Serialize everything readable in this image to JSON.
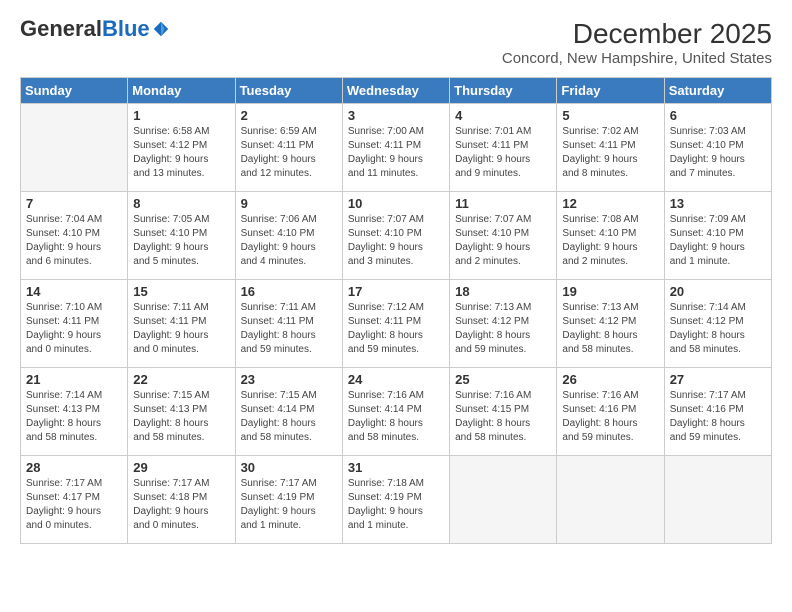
{
  "header": {
    "logo_general": "General",
    "logo_blue": "Blue",
    "title": "December 2025",
    "subtitle": "Concord, New Hampshire, United States"
  },
  "calendar": {
    "days_of_week": [
      "Sunday",
      "Monday",
      "Tuesday",
      "Wednesday",
      "Thursday",
      "Friday",
      "Saturday"
    ],
    "weeks": [
      [
        {
          "day": "",
          "info": ""
        },
        {
          "day": "1",
          "info": "Sunrise: 6:58 AM\nSunset: 4:12 PM\nDaylight: 9 hours\nand 13 minutes."
        },
        {
          "day": "2",
          "info": "Sunrise: 6:59 AM\nSunset: 4:11 PM\nDaylight: 9 hours\nand 12 minutes."
        },
        {
          "day": "3",
          "info": "Sunrise: 7:00 AM\nSunset: 4:11 PM\nDaylight: 9 hours\nand 11 minutes."
        },
        {
          "day": "4",
          "info": "Sunrise: 7:01 AM\nSunset: 4:11 PM\nDaylight: 9 hours\nand 9 minutes."
        },
        {
          "day": "5",
          "info": "Sunrise: 7:02 AM\nSunset: 4:11 PM\nDaylight: 9 hours\nand 8 minutes."
        },
        {
          "day": "6",
          "info": "Sunrise: 7:03 AM\nSunset: 4:10 PM\nDaylight: 9 hours\nand 7 minutes."
        }
      ],
      [
        {
          "day": "7",
          "info": "Sunrise: 7:04 AM\nSunset: 4:10 PM\nDaylight: 9 hours\nand 6 minutes."
        },
        {
          "day": "8",
          "info": "Sunrise: 7:05 AM\nSunset: 4:10 PM\nDaylight: 9 hours\nand 5 minutes."
        },
        {
          "day": "9",
          "info": "Sunrise: 7:06 AM\nSunset: 4:10 PM\nDaylight: 9 hours\nand 4 minutes."
        },
        {
          "day": "10",
          "info": "Sunrise: 7:07 AM\nSunset: 4:10 PM\nDaylight: 9 hours\nand 3 minutes."
        },
        {
          "day": "11",
          "info": "Sunrise: 7:07 AM\nSunset: 4:10 PM\nDaylight: 9 hours\nand 2 minutes."
        },
        {
          "day": "12",
          "info": "Sunrise: 7:08 AM\nSunset: 4:10 PM\nDaylight: 9 hours\nand 2 minutes."
        },
        {
          "day": "13",
          "info": "Sunrise: 7:09 AM\nSunset: 4:10 PM\nDaylight: 9 hours\nand 1 minute."
        }
      ],
      [
        {
          "day": "14",
          "info": "Sunrise: 7:10 AM\nSunset: 4:11 PM\nDaylight: 9 hours\nand 0 minutes."
        },
        {
          "day": "15",
          "info": "Sunrise: 7:11 AM\nSunset: 4:11 PM\nDaylight: 9 hours\nand 0 minutes."
        },
        {
          "day": "16",
          "info": "Sunrise: 7:11 AM\nSunset: 4:11 PM\nDaylight: 8 hours\nand 59 minutes."
        },
        {
          "day": "17",
          "info": "Sunrise: 7:12 AM\nSunset: 4:11 PM\nDaylight: 8 hours\nand 59 minutes."
        },
        {
          "day": "18",
          "info": "Sunrise: 7:13 AM\nSunset: 4:12 PM\nDaylight: 8 hours\nand 59 minutes."
        },
        {
          "day": "19",
          "info": "Sunrise: 7:13 AM\nSunset: 4:12 PM\nDaylight: 8 hours\nand 58 minutes."
        },
        {
          "day": "20",
          "info": "Sunrise: 7:14 AM\nSunset: 4:12 PM\nDaylight: 8 hours\nand 58 minutes."
        }
      ],
      [
        {
          "day": "21",
          "info": "Sunrise: 7:14 AM\nSunset: 4:13 PM\nDaylight: 8 hours\nand 58 minutes."
        },
        {
          "day": "22",
          "info": "Sunrise: 7:15 AM\nSunset: 4:13 PM\nDaylight: 8 hours\nand 58 minutes."
        },
        {
          "day": "23",
          "info": "Sunrise: 7:15 AM\nSunset: 4:14 PM\nDaylight: 8 hours\nand 58 minutes."
        },
        {
          "day": "24",
          "info": "Sunrise: 7:16 AM\nSunset: 4:14 PM\nDaylight: 8 hours\nand 58 minutes."
        },
        {
          "day": "25",
          "info": "Sunrise: 7:16 AM\nSunset: 4:15 PM\nDaylight: 8 hours\nand 58 minutes."
        },
        {
          "day": "26",
          "info": "Sunrise: 7:16 AM\nSunset: 4:16 PM\nDaylight: 8 hours\nand 59 minutes."
        },
        {
          "day": "27",
          "info": "Sunrise: 7:17 AM\nSunset: 4:16 PM\nDaylight: 8 hours\nand 59 minutes."
        }
      ],
      [
        {
          "day": "28",
          "info": "Sunrise: 7:17 AM\nSunset: 4:17 PM\nDaylight: 9 hours\nand 0 minutes."
        },
        {
          "day": "29",
          "info": "Sunrise: 7:17 AM\nSunset: 4:18 PM\nDaylight: 9 hours\nand 0 minutes."
        },
        {
          "day": "30",
          "info": "Sunrise: 7:17 AM\nSunset: 4:19 PM\nDaylight: 9 hours\nand 1 minute."
        },
        {
          "day": "31",
          "info": "Sunrise: 7:18 AM\nSunset: 4:19 PM\nDaylight: 9 hours\nand 1 minute."
        },
        {
          "day": "",
          "info": ""
        },
        {
          "day": "",
          "info": ""
        },
        {
          "day": "",
          "info": ""
        }
      ]
    ]
  }
}
